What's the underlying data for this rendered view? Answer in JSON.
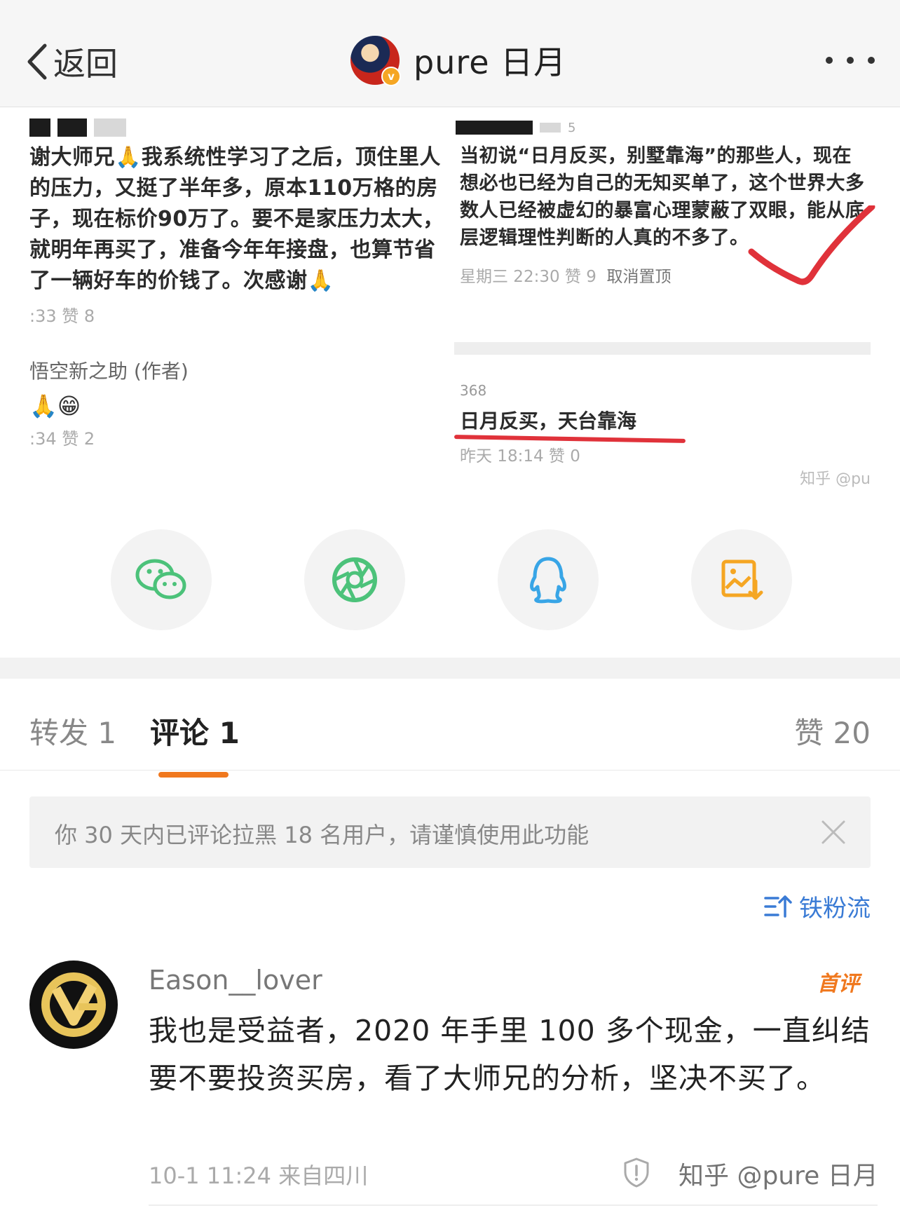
{
  "nav": {
    "back_label": "返回",
    "username": "pure 日月",
    "verified_mark": "v"
  },
  "shared_image": {
    "left_post": {
      "text": "谢大师兄🙏我系统性学习了之后，顶住里人的压力，又挺了半年多，原本110万格的房子，现在标价90万了。要不是家压力太大，就明年再买了，准备今年年接盘，也算节省了一辆好车的价钱了。次感谢🙏",
      "meta": ":33  赞 8",
      "reply_author": "悟空新之助 (作者)",
      "reply_emoji": "🙏😁",
      "reply_meta": ":34  赞 2"
    },
    "right_post": {
      "head_count": "5",
      "text": "当初说“日月反买，别墅靠海”的那些人，现在想必也已经为自己的无知买单了，这个世界大多数人已经被虚幻的暴富心理蒙蔽了双眼，能从底层逻辑理性判断的人真的不多了。",
      "meta": "星期三 22:30  赞 9",
      "meta_action": "取消置顶",
      "reply_head": "368",
      "reply_text": "日月反买，天台靠海",
      "reply_meta": "昨天 18:14  赞 0",
      "watermark": "知乎 @pu"
    }
  },
  "share_icons": [
    "wechat-icon",
    "moments-icon",
    "qq-icon",
    "save-image-icon"
  ],
  "tabs": {
    "repost": "转发 1",
    "comment": "评论 1",
    "like": "赞 20"
  },
  "notice": {
    "text": "你 30 天内已评论拉黑 18 名用户，请谨慎使用此功能"
  },
  "sort": {
    "label": "铁粉流"
  },
  "comment": {
    "username": "Eason__lover",
    "badge": "首评",
    "text": "我也是受益者，2020 年手里 100 多个现金，一直纠结要不要投资买房，看了大师兄的分析，坚决不买了。",
    "meta": "10-1 11:24  来自四川",
    "watermark": "知乎 @pure 日月"
  },
  "colors": {
    "accent_orange": "#f0781e",
    "link_blue": "#3a7bd5",
    "wechat_green": "#4cc27a",
    "qq_blue": "#38a5e6",
    "save_orange": "#f5a623"
  }
}
